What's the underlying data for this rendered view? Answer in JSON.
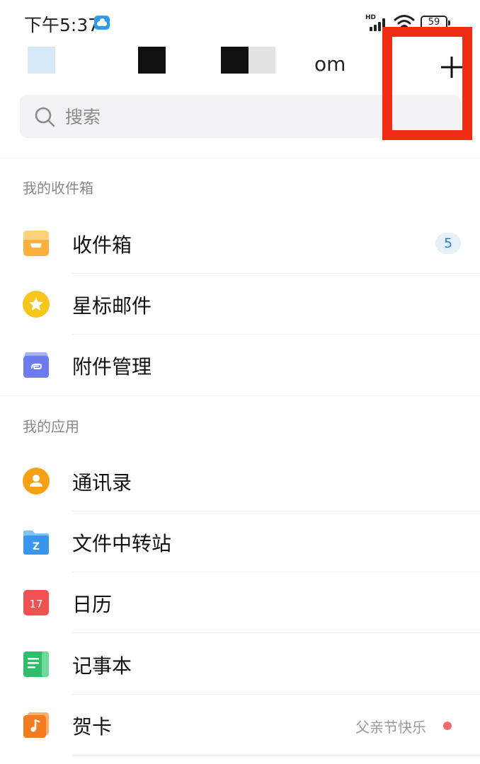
{
  "status_bar": {
    "time": "下午5:37",
    "network_label": "HD",
    "battery": "59"
  },
  "account": {
    "email_suffix": "om"
  },
  "search": {
    "placeholder": "搜索"
  },
  "mailbox_section": {
    "title": "我的收件箱",
    "items": [
      {
        "label": "收件箱",
        "icon": "inbox-icon",
        "badge": "5"
      },
      {
        "label": "星标邮件",
        "icon": "star-icon"
      },
      {
        "label": "附件管理",
        "icon": "attachment-icon"
      }
    ]
  },
  "apps_section": {
    "title": "我的应用",
    "items": [
      {
        "label": "通讯录",
        "icon": "contacts-icon"
      },
      {
        "label": "文件中转站",
        "icon": "file-transfer-icon"
      },
      {
        "label": "日历",
        "icon": "calendar-icon",
        "icon_text": "17"
      },
      {
        "label": "记事本",
        "icon": "notepad-icon"
      },
      {
        "label": "贺卡",
        "icon": "greeting-card-icon",
        "promo": "父亲节快乐"
      }
    ]
  },
  "colors": {
    "highlight": "#f02c14",
    "badge_bg": "#e5f0fb",
    "badge_text": "#2b7fd6",
    "promo_dot": "#f26b6b"
  }
}
